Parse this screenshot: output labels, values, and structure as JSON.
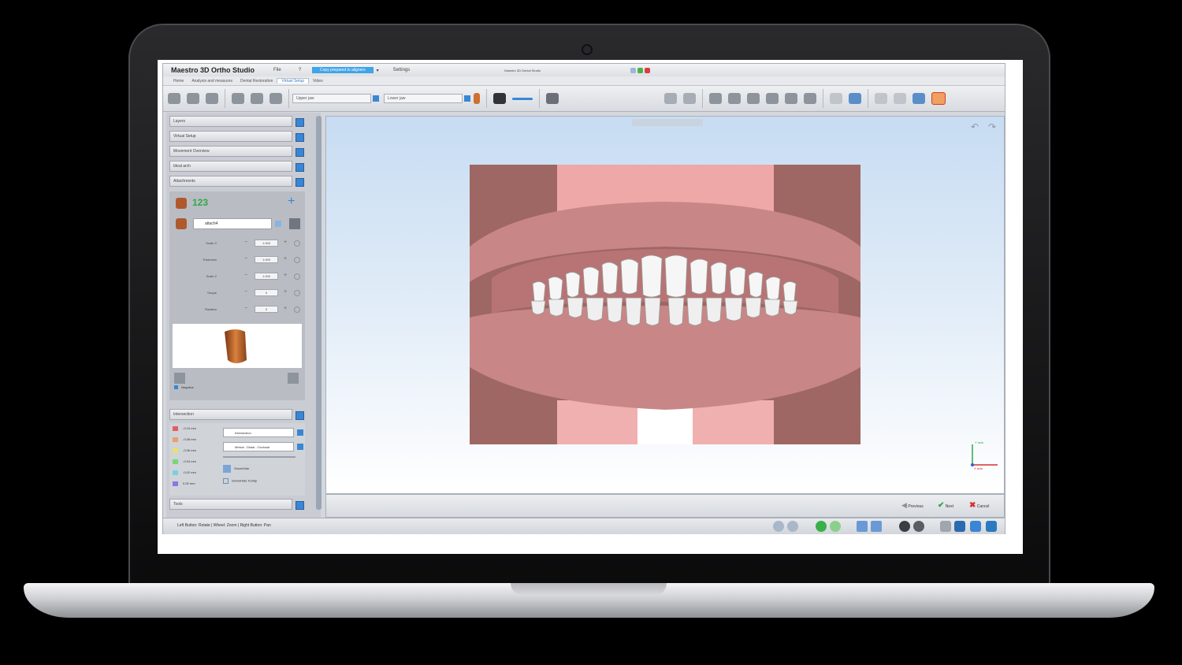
{
  "app": {
    "title": "Maestro 3D Ortho Studio",
    "menu_file": "File",
    "menu_q": "?",
    "active_action": "Copy prepared to aligners",
    "menu_settings": "Settings",
    "project_title": "Maestro 3D Dental Studio"
  },
  "tabs": [
    "Home",
    "Analysis and measures",
    "Dental Restoration",
    "Virtual Setup",
    "Video"
  ],
  "toolbar": {
    "upper_jaw": "Upper jaw",
    "lower_jaw": "Lower jaw"
  },
  "panel": {
    "sections": [
      "Layers",
      "Virtual Setup",
      "Movement Overview",
      "Ideal arch",
      "Attachments"
    ],
    "counter_label": "123",
    "attachment_name": "attach4",
    "params": [
      {
        "label": "Scale X",
        "value": "1.000"
      },
      {
        "label": "Thickness",
        "value": "1.000"
      },
      {
        "label": "Scale Z",
        "value": "1.000"
      },
      {
        "label": "Torque",
        "value": "0"
      },
      {
        "label": "Rotation",
        "value": "0"
      }
    ],
    "negative_label": "Negative",
    "intersection_title": "Intersection",
    "legend": [
      {
        "label": "-0.10 mm",
        "color": "#e06060"
      },
      {
        "label": "-0.08 mm",
        "color": "#e8a070"
      },
      {
        "label": "-0.06 mm",
        "color": "#e8e070"
      },
      {
        "label": "-0.04 mm",
        "color": "#78d878"
      },
      {
        "label": "-0.02 mm",
        "color": "#78d0e0"
      },
      {
        "label": "0.00 mm",
        "color": "#8878e0"
      }
    ],
    "intersection_field": "Intersection",
    "mode_field": "Mesial - Distal - Occlusal",
    "show_hide": "Show/Hide",
    "show_hide_tooltip": "Show/Hide Tooltip",
    "tools_title": "Tools"
  },
  "viewport": {
    "axis_y": "Y axis",
    "axis_x": "X axis"
  },
  "nav": {
    "previous": "Previous",
    "next": "Next",
    "cancel": "Cancel"
  },
  "status": {
    "hint": "Left Button: Rotate | Wheel: Zoom | Right Button: Pan"
  }
}
